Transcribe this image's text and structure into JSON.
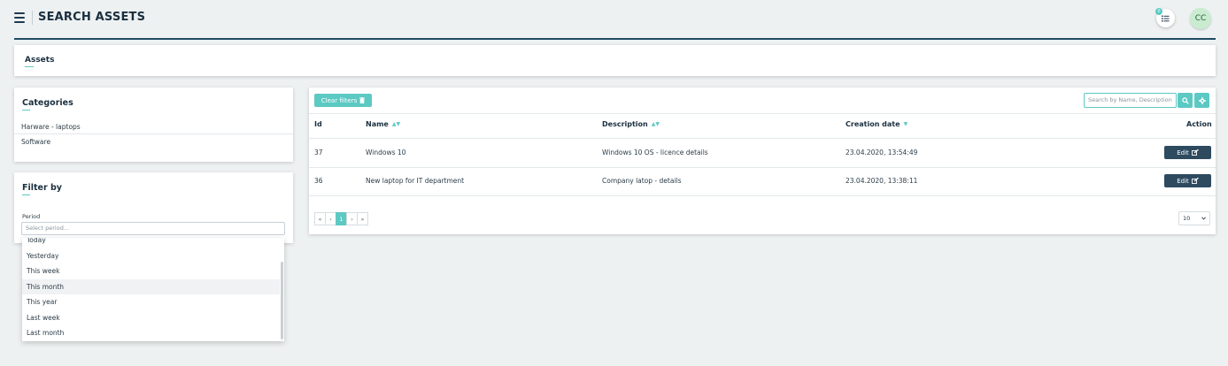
{
  "header": {
    "title": "SEARCH ASSETS",
    "task_badge": "0",
    "avatar": "CC"
  },
  "tabs": {
    "assets": "Assets"
  },
  "categories": {
    "title": "Categories",
    "items": [
      "Harware - laptops",
      "Software"
    ]
  },
  "filter": {
    "title": "Filter by",
    "period_label": "Period",
    "period_placeholder": "Select period...",
    "options": [
      "Today",
      "Yesterday",
      "This week",
      "This month",
      "This year",
      "Last week",
      "Last month"
    ],
    "hovered_option": "This month"
  },
  "table": {
    "clear_filters": "Clear filters",
    "search_placeholder": "Search by Name, Description",
    "columns": {
      "id": "Id",
      "name": "Name",
      "description": "Description",
      "creation_date": "Creation date",
      "action": "Action"
    },
    "rows": [
      {
        "id": "37",
        "name": "Windows 10",
        "description": "Windows 10 OS - licence details",
        "creation_date": "23.04.2020, 13:54:49",
        "action": "Edit"
      },
      {
        "id": "36",
        "name": "New laptop for IT department",
        "description": "Company latop - details",
        "creation_date": "23.04.2020, 13:38:11",
        "action": "Edit"
      }
    ],
    "pagination": {
      "first": "«",
      "prev": "‹",
      "current": "1",
      "next": "›",
      "last": "»"
    },
    "per_page": "10"
  },
  "colors": {
    "accent": "#5cc9c3",
    "primary": "#2d4a5f",
    "background": "#eef1f2"
  }
}
